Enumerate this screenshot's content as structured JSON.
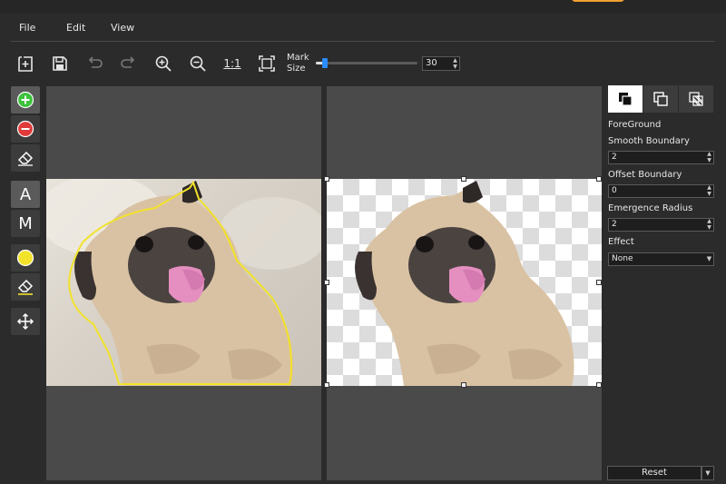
{
  "menu": {
    "file": "File",
    "edit": "Edit",
    "view": "View"
  },
  "toolbar": {
    "actual_size_label": "1:1",
    "mark_size_label_1": "Mark",
    "mark_size_label_2": "Size",
    "mark_size_value": "30",
    "mark_size_fraction": 0.09
  },
  "left_tools": {
    "auto_label": "A",
    "manual_label": "M",
    "marker_color": "#f2e22a"
  },
  "right_panel": {
    "section_title": "ForeGround",
    "smooth_boundary_label": "Smooth Boundary",
    "smooth_boundary_value": "2",
    "offset_boundary_label": "Offset Boundary",
    "offset_boundary_value": "0",
    "emergence_radius_label": "Emergence Radius",
    "emergence_radius_value": "2",
    "effect_label": "Effect",
    "effect_value": "None",
    "reset_label": "Reset"
  },
  "colors": {
    "accent": "#2a8cff",
    "selection_outline": "#f2e22a",
    "add_green": "#3cc23c",
    "remove_red": "#e03a3a"
  }
}
